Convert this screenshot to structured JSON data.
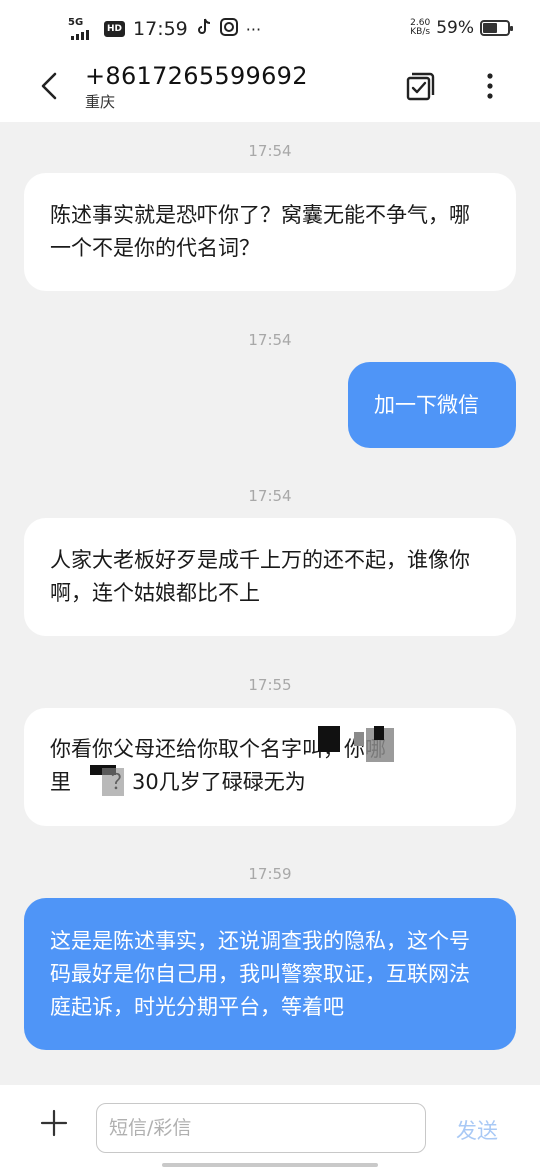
{
  "status_bar": {
    "network": "5G",
    "hd": "HD",
    "time": "17:59",
    "tiktok_icon": "tiktok-icon",
    "app_icon": "camera-app-icon",
    "more": "···",
    "speed_value": "2.60",
    "speed_unit": "KB/s",
    "battery_percent": "59%",
    "battery_level": 0.59
  },
  "header": {
    "number": "+8617265599692",
    "location": "重庆"
  },
  "messages": [
    {
      "time": "17:54",
      "direction": "in",
      "text": "陈述事实就是恐吓你了？窝囊无能不争气，哪一个不是你的代名词？"
    },
    {
      "time": "17:54",
      "direction": "out",
      "text": "加一下微信"
    },
    {
      "time": "17:54",
      "direction": "in",
      "text": "人家大老板好歹是成千上万的还不起，谁像你啊，连个姑娘都比不上"
    },
    {
      "time": "17:55",
      "direction": "in",
      "line1": "你看你父母还给你取个名字叫",
      "line1_end": "，你哪",
      "line2_start": "里",
      "line2_end": "？30几岁了碌碌无为"
    },
    {
      "time": "17:59",
      "direction": "out",
      "text": "这是是陈述事实，还说调查我的隐私，这个号码最好是你自己用，我叫警察取证，互联网法庭起诉，时光分期平台，等着吧"
    }
  ],
  "input": {
    "placeholder": "短信/彩信",
    "send_label": "发送"
  },
  "colors": {
    "outgoing_bubble": "#4f95f7",
    "incoming_bubble": "#ffffff",
    "background": "#f1f1f1",
    "send_disabled": "#a9c9f5"
  }
}
